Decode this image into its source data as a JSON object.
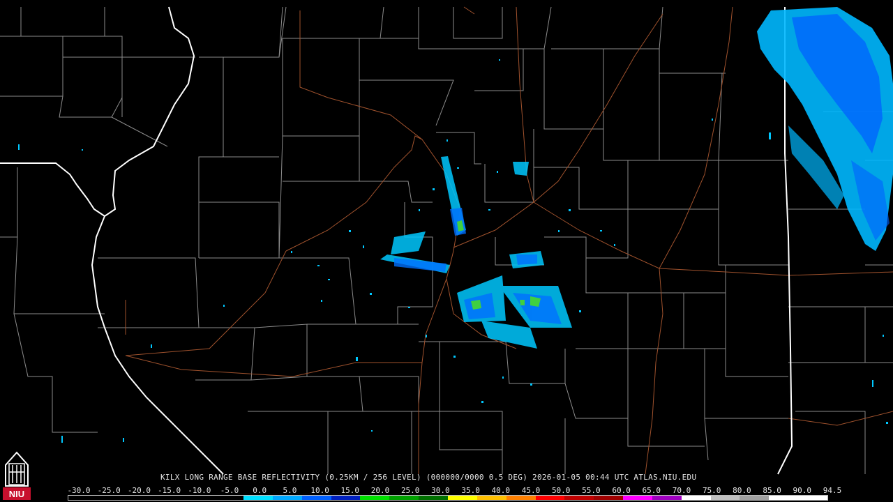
{
  "product_title": "KILX LONG RANGE BASE REFLECTIVITY (0.25KM / 256 LEVEL) (000000/0000 0.5 DEG) 2026-01-05 00:44 UTC  ATLAS.NIU.EDU",
  "logo_text": "NIU",
  "scale_labels": [
    "-30.0",
    "-25.0",
    "-20.0",
    "-15.0",
    "-10.0",
    "-5.0",
    "0.0",
    "5.0",
    "10.0",
    "15.0",
    "20.0",
    "25.0",
    "30.0",
    "35.0",
    "40.0",
    "45.0",
    "50.0",
    "55.0",
    "60.0",
    "65.0",
    "70.0",
    "75.0",
    "80.0",
    "85.0",
    "90.0",
    "94.5"
  ],
  "scale_colors": [
    "#000000",
    "#000000",
    "#000000",
    "#000000",
    "#000000",
    "#000000",
    "#00e0ff",
    "#00a8ff",
    "#0060ff",
    "#0020c0",
    "#00e000",
    "#00a000",
    "#007000",
    "#ffff00",
    "#ffc000",
    "#ff8000",
    "#ff0000",
    "#c00000",
    "#a00000",
    "#ff00ff",
    "#a000c0",
    "#ffffff",
    "#c0c0c0",
    "#a0a0a0",
    "#ffffff",
    "#ffffff"
  ],
  "colors": {
    "state_border": "#ffffff",
    "county_border": "#8c8c8c",
    "highway": "#a0522d",
    "echo_light": "#00c8ff",
    "echo_mid": "#0070ff",
    "echo_green": "#40d040"
  }
}
